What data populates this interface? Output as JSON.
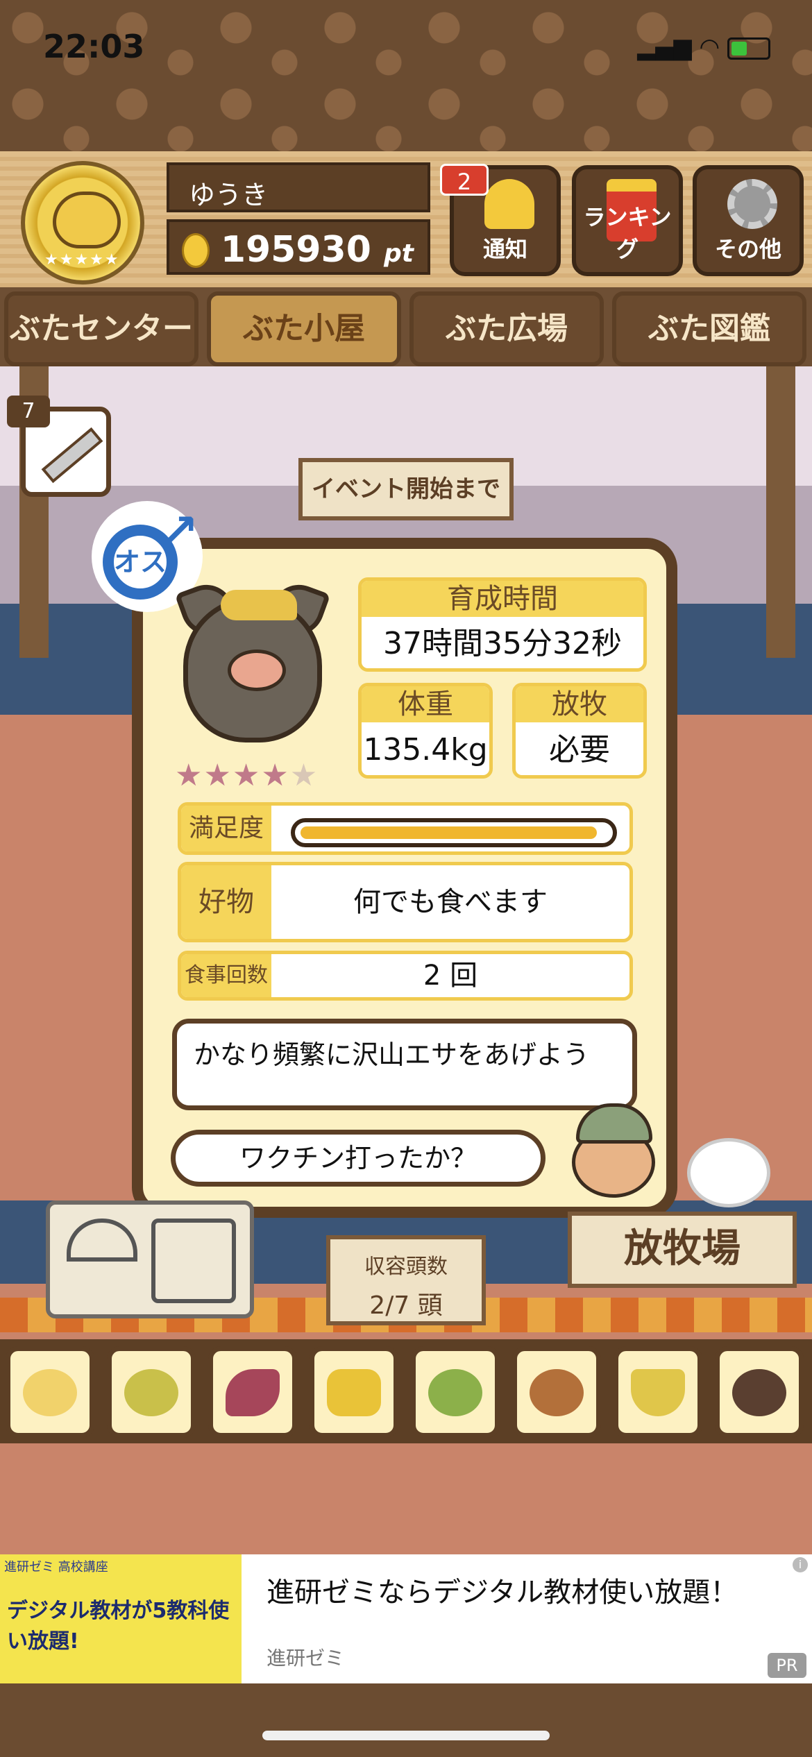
{
  "status": {
    "time": "22:03"
  },
  "header": {
    "user_name": "ゆうき",
    "points": "195930",
    "points_unit": "pt",
    "notification_count": "2",
    "buttons": [
      {
        "label": "通知"
      },
      {
        "label": "ランキング"
      },
      {
        "label": "その他"
      }
    ]
  },
  "tabs": [
    "ぶたセンター",
    "ぶた小屋",
    "ぶた広場",
    "ぶた図鑑"
  ],
  "scene": {
    "syringe_count": "7",
    "event_sign": "イベント開始まで"
  },
  "pig_card": {
    "gender_label": "オス",
    "rating_stars": 4,
    "rating_max": 5,
    "growth_time": {
      "label": "育成時間",
      "value": "37時間35分32秒"
    },
    "weight": {
      "label": "体重",
      "value": "135.4kg"
    },
    "grazing": {
      "label": "放牧",
      "value": "必要"
    },
    "satisfaction": {
      "label": "満足度",
      "level": 0.97
    },
    "favorite": {
      "label": "好物",
      "value": "何でも食べます"
    },
    "meals": {
      "label": "食事回数",
      "value": "2 回"
    },
    "advice": "かなり頻繁に沢山エサをあげよう",
    "farmer_speech": "ワクチン打ったか？"
  },
  "bottom": {
    "capacity_label": "収容頭数",
    "capacity_value": "2/7 頭",
    "pasture_label": "放牧場",
    "feeds": [
      "feed-grain",
      "feed-green-grain",
      "feed-sweet-potato",
      "feed-corn",
      "feed-beans",
      "feed-acorn",
      "feed-bowl",
      "feed-truffle"
    ]
  },
  "ad": {
    "brand": "進研ゼミ 高校講座",
    "image_text": "デジタル教材が5教科使い放題!",
    "title": "進研ゼミならデジタル教材使い放題！",
    "advertiser": "進研ゼミ",
    "pr": "PR"
  },
  "colors": {
    "accent_yellow": "#f5d55a",
    "wood_dark": "#5c3f25",
    "male_blue": "#2f6fc2"
  }
}
